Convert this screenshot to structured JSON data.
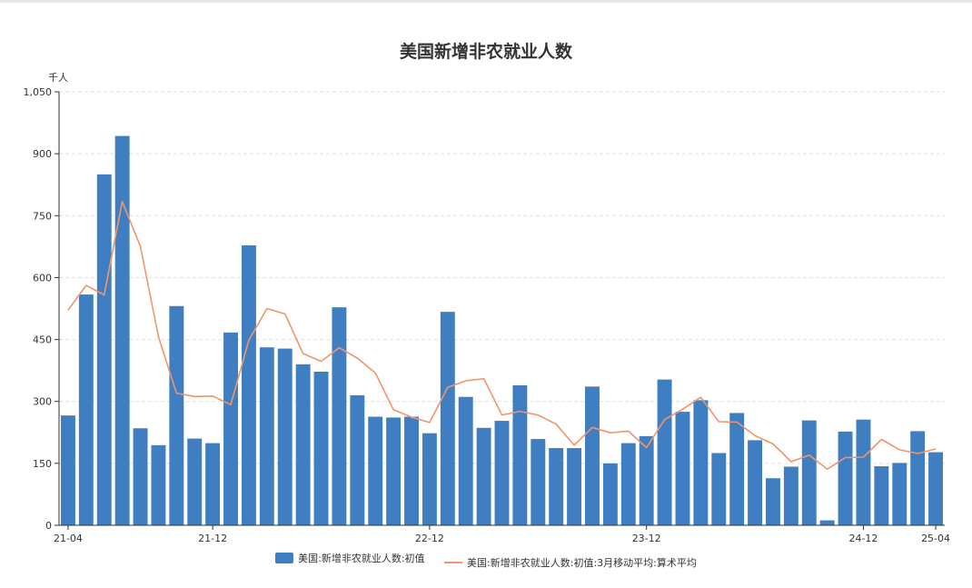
{
  "chart_data": {
    "type": "bar",
    "title": "美国新增非农就业人数",
    "unit_label": "千人",
    "ylim": [
      0,
      1050
    ],
    "yticks": [
      0,
      150,
      300,
      450,
      600,
      750,
      900,
      1050
    ],
    "ytick_labels": [
      "0",
      "150",
      "300",
      "450",
      "600",
      "750",
      "900",
      "1,050"
    ],
    "grid": true,
    "legend_position": "bottom",
    "x": [
      "21-04",
      "21-05",
      "21-06",
      "21-07",
      "21-08",
      "21-09",
      "21-10",
      "21-11",
      "21-12",
      "22-01",
      "22-02",
      "22-03",
      "22-04",
      "22-05",
      "22-06",
      "22-07",
      "22-08",
      "22-09",
      "22-10",
      "22-11",
      "22-12",
      "23-01",
      "23-02",
      "23-03",
      "23-04",
      "23-05",
      "23-06",
      "23-07",
      "23-08",
      "23-09",
      "23-10",
      "23-11",
      "23-12",
      "24-01",
      "24-02",
      "24-03",
      "24-04",
      "24-05",
      "24-06",
      "24-07",
      "24-08",
      "24-09",
      "24-10",
      "24-11",
      "24-12",
      "25-01",
      "25-02",
      "25-03",
      "25-04"
    ],
    "x_tick_labels": [
      "21-04",
      "21-12",
      "22-12",
      "23-12",
      "24-12",
      "25-04"
    ],
    "series": [
      {
        "name": "美国:新增非农就业人数:初值",
        "type": "bar",
        "color": "#3f7fc1",
        "values": [
          266,
          559,
          850,
          943,
          235,
          194,
          531,
          210,
          199,
          467,
          678,
          431,
          428,
          390,
          372,
          528,
          315,
          263,
          261,
          263,
          223,
          517,
          311,
          236,
          253,
          339,
          209,
          187,
          187,
          336,
          150,
          199,
          216,
          353,
          275,
          303,
          175,
          272,
          206,
          114,
          142,
          254,
          12,
          227,
          256,
          143,
          151,
          228,
          177
        ]
      },
      {
        "name": "美国:新增非农就业人数:初值:3月移动平均:算术平均",
        "type": "line",
        "color": "#f0956b",
        "values": [
          521,
          581,
          558,
          784,
          676,
          457,
          320,
          312,
          313,
          292,
          448,
          525,
          512,
          416,
          397,
          430,
          405,
          369,
          280,
          262,
          249,
          334,
          350,
          355,
          267,
          276,
          267,
          245,
          194,
          237,
          224,
          228,
          188,
          256,
          281,
          310,
          251,
          250,
          217,
          197,
          154,
          170,
          136,
          164,
          165,
          208,
          183,
          174,
          185
        ]
      }
    ]
  }
}
